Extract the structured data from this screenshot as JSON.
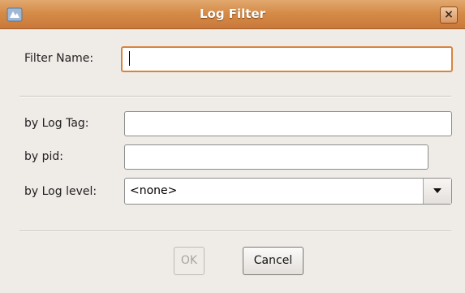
{
  "window": {
    "title": "Log Filter",
    "close_label": "×"
  },
  "form": {
    "filter_name_label": "Filter Name:",
    "filter_name_value": "",
    "log_tag_label": "by Log Tag:",
    "log_tag_value": "",
    "pid_label": "by pid:",
    "pid_value": "",
    "log_level_label": "by Log level:",
    "log_level_selected": "<none>"
  },
  "buttons": {
    "ok_label": "OK",
    "cancel_label": "Cancel"
  },
  "colors": {
    "titlebar": "#d58c48",
    "focus_ring": "#d9843e",
    "dialog_bg": "#efebe7"
  }
}
